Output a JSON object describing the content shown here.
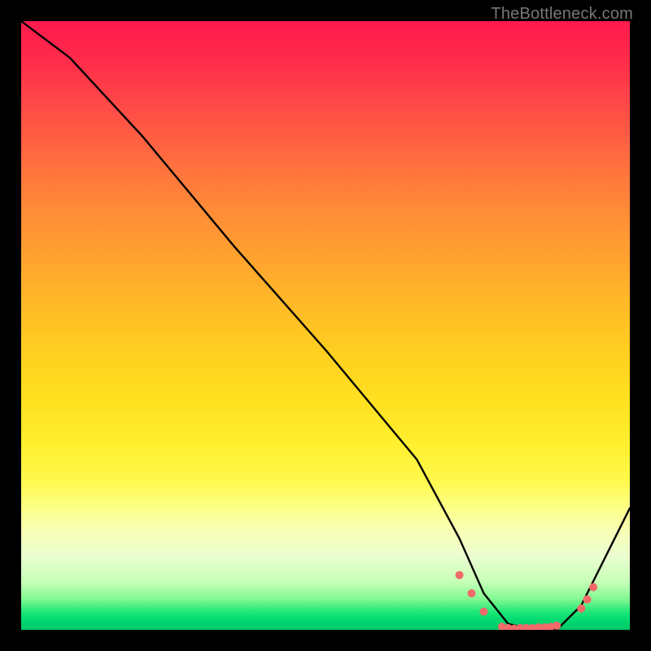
{
  "watermark": "TheBottleneck.com",
  "chart_data": {
    "type": "line",
    "title": "",
    "xlabel": "",
    "ylabel": "",
    "xlim": [
      0,
      100
    ],
    "ylim": [
      0,
      100
    ],
    "series": [
      {
        "name": "curve",
        "x": [
          0,
          4,
          8,
          20,
          35,
          50,
          65,
          72,
          76,
          80,
          84,
          88,
          92,
          96,
          100
        ],
        "values": [
          100,
          97,
          94,
          81,
          63,
          46,
          28,
          15,
          6,
          1,
          0,
          0,
          4,
          12,
          20
        ]
      }
    ],
    "markers": {
      "name": "flat-region-dots",
      "x": [
        72,
        74,
        76,
        79,
        80,
        81,
        82,
        83,
        84,
        85,
        86,
        87,
        88,
        92,
        93,
        94
      ],
      "values": [
        9,
        6,
        3,
        0.5,
        0.3,
        0.2,
        0.3,
        0.3,
        0.3,
        0.4,
        0.4,
        0.5,
        0.7,
        3.5,
        5,
        7
      ]
    },
    "gradient_legend_note": "y=0 green, y≈50 yellow, y=100 red"
  }
}
